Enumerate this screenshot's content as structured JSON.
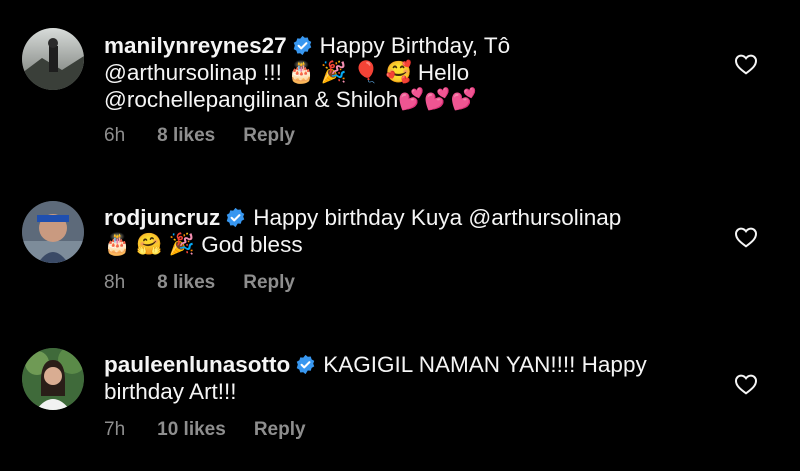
{
  "comments": [
    {
      "username": "manilynreynes27",
      "lines": [
        [
          "Happy Birthday, Tô"
        ],
        [
          "@arthursolinap !!!",
          "🎂",
          "🎉",
          "🎈",
          "🥰",
          "Hello"
        ],
        [
          "@rochellepangilinan & Shiloh",
          "💕💕💕"
        ]
      ],
      "time": "6h",
      "likes": "8 likes",
      "reply": "Reply"
    },
    {
      "username": "rodjuncruz",
      "lines": [
        [
          "Happy birthday Kuya @arthursolinap"
        ],
        [
          "🎂",
          "🤗",
          "🎉",
          "God bless"
        ]
      ],
      "time": "8h",
      "likes": "8 likes",
      "reply": "Reply"
    },
    {
      "username": "pauleenlunasotto",
      "lines": [
        [
          "KAGIGIL NAMAN YAN!!!! Happy"
        ],
        [
          "birthday Art!!!"
        ]
      ],
      "time": "7h",
      "likes": "10 likes",
      "reply": "Reply"
    }
  ],
  "colors": {
    "background": "#000000",
    "text": "#f5f5f5",
    "meta": "#8e8e8e",
    "verified": "#3897f0"
  },
  "icons": {
    "verified": "verified-badge-icon",
    "like": "heart-outline-icon"
  }
}
